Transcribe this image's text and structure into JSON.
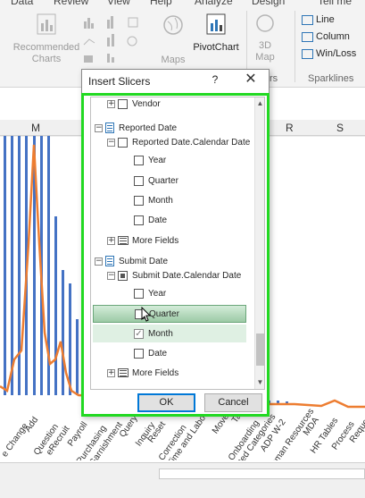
{
  "ribbon": {
    "tabs": [
      "Data",
      "Review",
      "View",
      "Help",
      "Analyze",
      "Design",
      "Tell me wh"
    ],
    "recommended_charts": "Recommended\nCharts",
    "maps": "Maps",
    "pivotchart": "PivotChart",
    "map3d": "3D\nMap",
    "tours_label": "rs",
    "sparklines": {
      "items": [
        "Line",
        "Column",
        "Win/Loss"
      ],
      "group_label": "Sparklines"
    }
  },
  "sheet": {
    "columns": [
      "M",
      "R",
      "S"
    ],
    "x_labels": [
      "e Change",
      "Add",
      "Question",
      "eRecruit",
      "Payroll",
      "Purchasing",
      "Garnishment",
      "Query",
      "Inquiry",
      "Reset",
      "Correction",
      "Time and Labo",
      "Move",
      "Ta",
      "Onboarding",
      "ated Categories",
      "ADP W-2",
      "uman Resources",
      "MDA",
      "HR Tables",
      "Process",
      "Reque"
    ]
  },
  "dialog": {
    "title": "Insert Slicers",
    "help": "?",
    "close": "✕",
    "items": [
      {
        "label": "Vendor",
        "kind": "field",
        "expander": "+"
      },
      {
        "label": "Reported Date",
        "kind": "table",
        "expander": "−"
      },
      {
        "label": "Reported Date.Calendar Date",
        "kind": "field",
        "expander": "−"
      },
      {
        "label": "Year",
        "kind": "field"
      },
      {
        "label": "Quarter",
        "kind": "field"
      },
      {
        "label": "Month",
        "kind": "field"
      },
      {
        "label": "Date",
        "kind": "field"
      },
      {
        "label": "More Fields",
        "kind": "more",
        "expander": "+"
      },
      {
        "label": "Submit Date",
        "kind": "table",
        "expander": "−"
      },
      {
        "label": "Submit Date.Calendar Date",
        "kind": "field",
        "expander": "−",
        "state": "partial"
      },
      {
        "label": "Year",
        "kind": "field"
      },
      {
        "label": "Quarter",
        "kind": "field",
        "state": "hover"
      },
      {
        "label": "Month",
        "kind": "field",
        "state": "checked"
      },
      {
        "label": "Date",
        "kind": "field"
      },
      {
        "label": "More Fields",
        "kind": "more",
        "expander": "+"
      }
    ],
    "ok": "OK",
    "cancel": "Cancel"
  }
}
